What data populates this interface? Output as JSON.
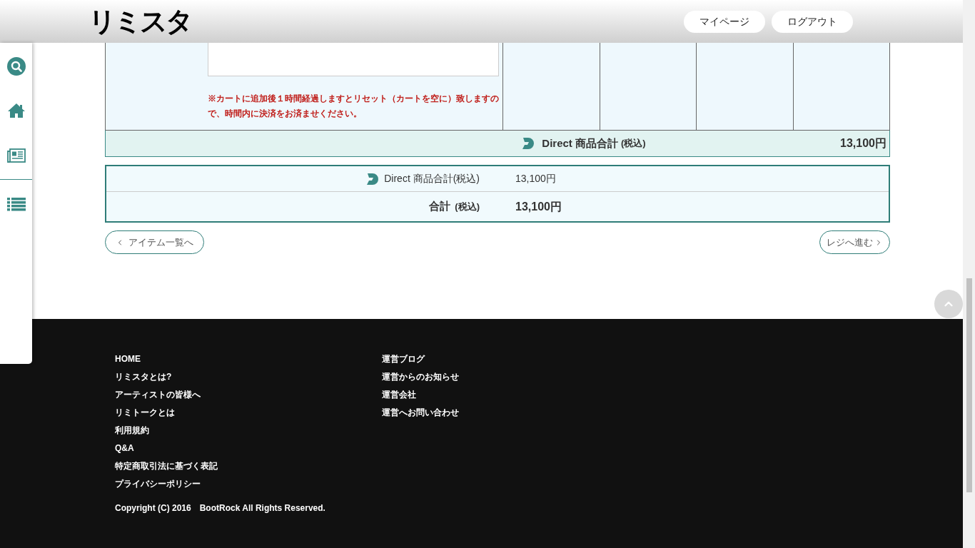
{
  "header": {
    "logo": "リミスタ",
    "buttons": [
      "マイページ",
      "ログアウト"
    ]
  },
  "cart": {
    "note": "※カートに追加後１時間経過しますとリセット（カートを空に）致しますので、時間内に決済をお済ませください。",
    "subtotal": {
      "label": "Direct 商品合計",
      "tax": "(税込)",
      "amount": "13,100円"
    }
  },
  "summary": {
    "rows": [
      {
        "kind": "line",
        "label": "Direct 商品合計(税込)",
        "amount": "13,100円"
      },
      {
        "kind": "total",
        "label": "合計",
        "tax": "(税込)",
        "amount": "13,100円"
      }
    ]
  },
  "nav": {
    "back": "アイテム一覧へ",
    "next": "レジへ進む"
  },
  "footer": {
    "columns": [
      [
        "HOME",
        "リミスタとは?",
        "アーティストの皆様へ",
        "リミトークとは",
        "利用規約",
        "Q&A",
        "特定商取引法に基づく表記",
        "プライバシーポリシー"
      ],
      [
        "運営ブログ",
        "運営からのお知らせ",
        "運営会社",
        "運営へお問い合わせ"
      ]
    ],
    "copyright": "Copyright (C) 2016　BootRock All Rights Reserved."
  }
}
